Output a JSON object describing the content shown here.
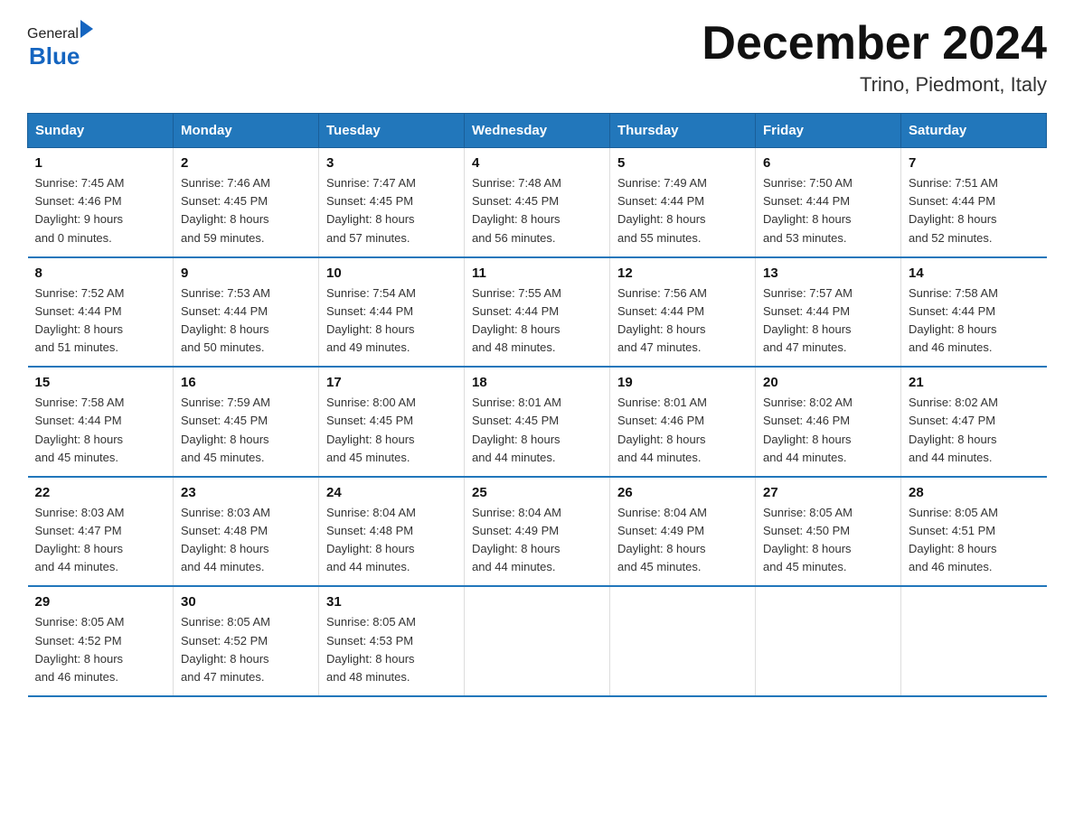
{
  "logo": {
    "general": "General",
    "blue": "Blue"
  },
  "title": "December 2024",
  "subtitle": "Trino, Piedmont, Italy",
  "days_of_week": [
    "Sunday",
    "Monday",
    "Tuesday",
    "Wednesday",
    "Thursday",
    "Friday",
    "Saturday"
  ],
  "weeks": [
    [
      {
        "day": "1",
        "sunrise": "7:45 AM",
        "sunset": "4:46 PM",
        "daylight": "9 hours and 0 minutes."
      },
      {
        "day": "2",
        "sunrise": "7:46 AM",
        "sunset": "4:45 PM",
        "daylight": "8 hours and 59 minutes."
      },
      {
        "day": "3",
        "sunrise": "7:47 AM",
        "sunset": "4:45 PM",
        "daylight": "8 hours and 57 minutes."
      },
      {
        "day": "4",
        "sunrise": "7:48 AM",
        "sunset": "4:45 PM",
        "daylight": "8 hours and 56 minutes."
      },
      {
        "day": "5",
        "sunrise": "7:49 AM",
        "sunset": "4:44 PM",
        "daylight": "8 hours and 55 minutes."
      },
      {
        "day": "6",
        "sunrise": "7:50 AM",
        "sunset": "4:44 PM",
        "daylight": "8 hours and 53 minutes."
      },
      {
        "day": "7",
        "sunrise": "7:51 AM",
        "sunset": "4:44 PM",
        "daylight": "8 hours and 52 minutes."
      }
    ],
    [
      {
        "day": "8",
        "sunrise": "7:52 AM",
        "sunset": "4:44 PM",
        "daylight": "8 hours and 51 minutes."
      },
      {
        "day": "9",
        "sunrise": "7:53 AM",
        "sunset": "4:44 PM",
        "daylight": "8 hours and 50 minutes."
      },
      {
        "day": "10",
        "sunrise": "7:54 AM",
        "sunset": "4:44 PM",
        "daylight": "8 hours and 49 minutes."
      },
      {
        "day": "11",
        "sunrise": "7:55 AM",
        "sunset": "4:44 PM",
        "daylight": "8 hours and 48 minutes."
      },
      {
        "day": "12",
        "sunrise": "7:56 AM",
        "sunset": "4:44 PM",
        "daylight": "8 hours and 47 minutes."
      },
      {
        "day": "13",
        "sunrise": "7:57 AM",
        "sunset": "4:44 PM",
        "daylight": "8 hours and 47 minutes."
      },
      {
        "day": "14",
        "sunrise": "7:58 AM",
        "sunset": "4:44 PM",
        "daylight": "8 hours and 46 minutes."
      }
    ],
    [
      {
        "day": "15",
        "sunrise": "7:58 AM",
        "sunset": "4:44 PM",
        "daylight": "8 hours and 45 minutes."
      },
      {
        "day": "16",
        "sunrise": "7:59 AM",
        "sunset": "4:45 PM",
        "daylight": "8 hours and 45 minutes."
      },
      {
        "day": "17",
        "sunrise": "8:00 AM",
        "sunset": "4:45 PM",
        "daylight": "8 hours and 45 minutes."
      },
      {
        "day": "18",
        "sunrise": "8:01 AM",
        "sunset": "4:45 PM",
        "daylight": "8 hours and 44 minutes."
      },
      {
        "day": "19",
        "sunrise": "8:01 AM",
        "sunset": "4:46 PM",
        "daylight": "8 hours and 44 minutes."
      },
      {
        "day": "20",
        "sunrise": "8:02 AM",
        "sunset": "4:46 PM",
        "daylight": "8 hours and 44 minutes."
      },
      {
        "day": "21",
        "sunrise": "8:02 AM",
        "sunset": "4:47 PM",
        "daylight": "8 hours and 44 minutes."
      }
    ],
    [
      {
        "day": "22",
        "sunrise": "8:03 AM",
        "sunset": "4:47 PM",
        "daylight": "8 hours and 44 minutes."
      },
      {
        "day": "23",
        "sunrise": "8:03 AM",
        "sunset": "4:48 PM",
        "daylight": "8 hours and 44 minutes."
      },
      {
        "day": "24",
        "sunrise": "8:04 AM",
        "sunset": "4:48 PM",
        "daylight": "8 hours and 44 minutes."
      },
      {
        "day": "25",
        "sunrise": "8:04 AM",
        "sunset": "4:49 PM",
        "daylight": "8 hours and 44 minutes."
      },
      {
        "day": "26",
        "sunrise": "8:04 AM",
        "sunset": "4:49 PM",
        "daylight": "8 hours and 45 minutes."
      },
      {
        "day": "27",
        "sunrise": "8:05 AM",
        "sunset": "4:50 PM",
        "daylight": "8 hours and 45 minutes."
      },
      {
        "day": "28",
        "sunrise": "8:05 AM",
        "sunset": "4:51 PM",
        "daylight": "8 hours and 46 minutes."
      }
    ],
    [
      {
        "day": "29",
        "sunrise": "8:05 AM",
        "sunset": "4:52 PM",
        "daylight": "8 hours and 46 minutes."
      },
      {
        "day": "30",
        "sunrise": "8:05 AM",
        "sunset": "4:52 PM",
        "daylight": "8 hours and 47 minutes."
      },
      {
        "day": "31",
        "sunrise": "8:05 AM",
        "sunset": "4:53 PM",
        "daylight": "8 hours and 48 minutes."
      },
      null,
      null,
      null,
      null
    ]
  ]
}
